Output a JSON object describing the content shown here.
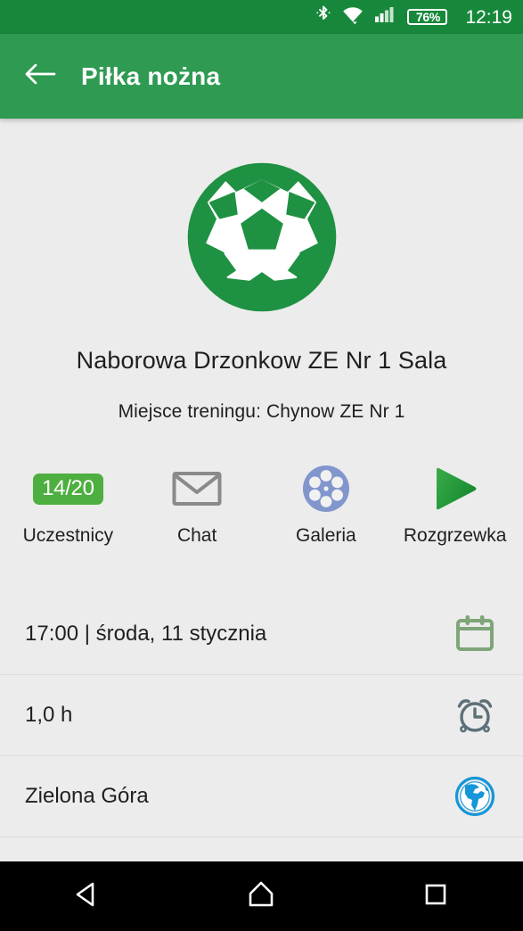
{
  "status_bar": {
    "bluetooth_icon": "bluetooth-icon",
    "wifi_icon": "wifi-icon",
    "signal_icon": "cellular-signal-icon",
    "battery_icon": "battery-icon",
    "battery_percent": "76%",
    "time": "12:19",
    "background_color": "#17883b",
    "foreground_color": "#ffffff"
  },
  "app_bar": {
    "back_icon": "back-arrow-icon",
    "title": "Piłka nożna",
    "background_color": "#2e9a52",
    "text_color": "#ffffff"
  },
  "hero": {
    "logo_icon": "soccer-ball-icon",
    "logo_color": "#1f9142",
    "title": "Naborowa Drzonkow ZE Nr 1 Sala",
    "subtitle": "Miejsce treningu: Chynow ZE Nr 1"
  },
  "actions": [
    {
      "id": "participants",
      "label": "Uczestnicy",
      "icon": "participants-count-badge",
      "badge_text": "14/20",
      "badge_color": "#4caf3f"
    },
    {
      "id": "chat",
      "label": "Chat",
      "icon": "envelope-icon",
      "icon_color": "#8a8a8a"
    },
    {
      "id": "gallery",
      "label": "Galeria",
      "icon": "film-reel-icon",
      "icon_color": "#8196cd"
    },
    {
      "id": "warmup",
      "label": "Rozgrzewka",
      "icon": "play-triangle-icon",
      "icon_color": "#2f9b3f"
    }
  ],
  "details": [
    {
      "id": "datetime",
      "text": "17:00 | środa, 11 stycznia",
      "icon": "calendar-icon",
      "icon_color": "#7fa579"
    },
    {
      "id": "duration",
      "text": "1,0 h",
      "icon": "alarm-clock-icon",
      "icon_color": "#5d7078"
    },
    {
      "id": "location",
      "text": "Zielona Góra",
      "icon": "globe-icon",
      "icon_color": "#1596d8"
    }
  ],
  "nav_bar": {
    "back_icon": "nav-back-icon",
    "home_icon": "nav-home-icon",
    "recents_icon": "nav-recents-icon",
    "background_color": "#000000"
  },
  "theme": {
    "page_background": "#ececec",
    "primary_text": "#1f1f1f",
    "divider": "#dcdcdc"
  }
}
